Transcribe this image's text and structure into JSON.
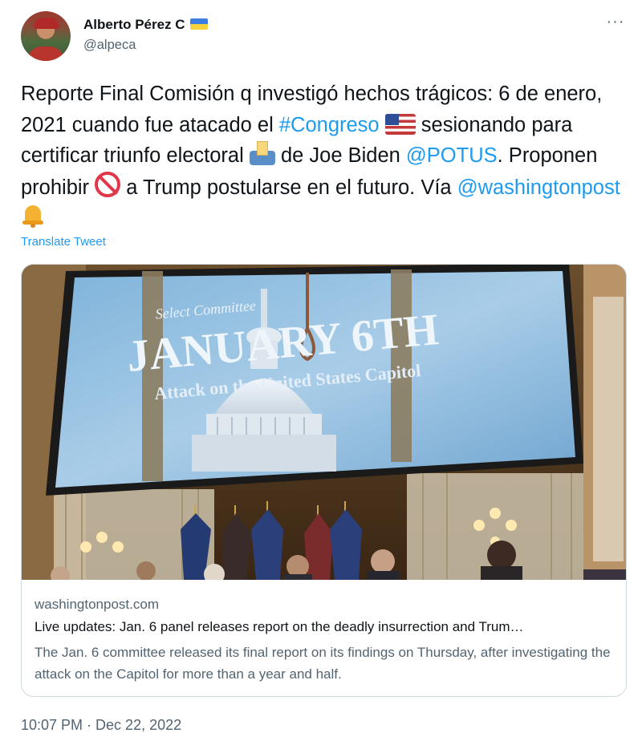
{
  "author": {
    "name": "Alberto Pérez C",
    "handle": "@alpeca",
    "avatar_icon": "avatar-photo"
  },
  "tweet": {
    "text_parts": [
      "Reporte Final Comisión q investigó hechos trágicos: 6 de enero, 2021 cuando fue atacado el ",
      "#Congreso",
      "sesionando para certificar triunfo electoral ",
      " de Joe Biden ",
      "@POTUS",
      ". Proponen prohibir ",
      " a Trump postularse en el futuro. Vía ",
      "@washingtonpost"
    ],
    "emoji_icons": [
      "us-flag-icon",
      "ballot-box-icon",
      "prohibited-icon",
      "bell-icon"
    ],
    "link_color": "#1d9bf0"
  },
  "translate_label": "Translate Tweet",
  "link_card": {
    "image_text": {
      "top": "Select Committee",
      "headline": "JANUARY 6TH",
      "subtitle": "Attack on the United States Capitol"
    },
    "domain": "washingtonpost.com",
    "title": "Live updates: Jan. 6 panel releases report on the deadly insurrection and Trum…",
    "description": "The Jan. 6 committee released its final report on its findings on Thursday, after investigating the attack on the Capitol for more than a year and half."
  },
  "timestamp": "10:07 PM · Dec 22, 2022",
  "more_icon": "ellipsis-icon",
  "colors": {
    "text_primary": "#0f1419",
    "text_secondary": "#536471",
    "border": "#cfd9de"
  }
}
